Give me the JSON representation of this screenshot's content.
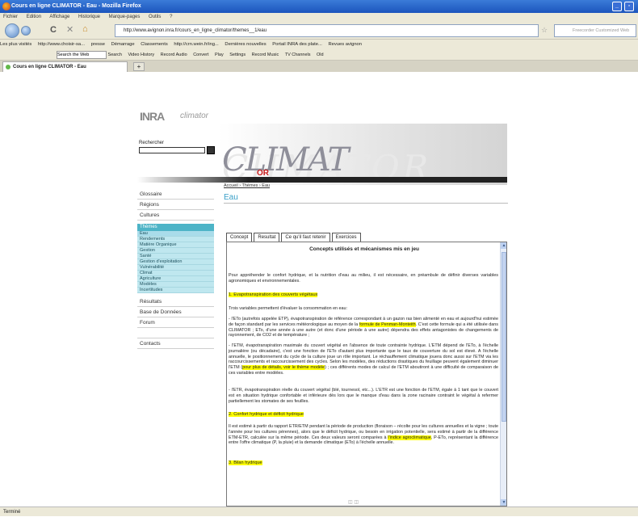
{
  "window": {
    "title": "Cours en ligne CLIMATOR - Eau - Mozilla Firefox"
  },
  "menu": [
    "Fichier",
    "Edition",
    "Affichage",
    "Historique",
    "Marque-pages",
    "Outils",
    "?"
  ],
  "nav": {
    "url": "http://www.avignon.inra.fr/cours_en_ligne_climator/themes__1/eau",
    "search_placeholder": "Freecorder Customized Web Search"
  },
  "bookmarks": [
    "Les plus visités",
    "http://www.choisir-sa...",
    "presse",
    "Démarrage",
    "Classements",
    "http://crn.wein.fr/ing...",
    "Dernières nouvelles",
    "Portail INRA des plate...",
    "Revues avignon"
  ],
  "toolbar2": {
    "search_value": "Search the Web",
    "items": [
      "Search",
      "Video History",
      "Record Audio",
      "Convert",
      "Play",
      "Settings",
      "Record Music",
      "TV Channels",
      "Old"
    ]
  },
  "tab": {
    "label": "Cours en ligne CLIMATOR - Eau",
    "new_tab": "+"
  },
  "site": {
    "logo_inra": "INRA",
    "logo_small": "climator",
    "search_label": "Rechercher",
    "banner_title": "CLIMAT",
    "banner_ghost": "ClIMATOR",
    "banner_or": "OR"
  },
  "sidebar": {
    "top_items": [
      "Glossaire",
      "Régions",
      "Cultures"
    ],
    "themes_head": "Thèmes",
    "themes": [
      "Eau",
      "Rendements",
      "Matière Organique",
      "Gestion",
      "Santé",
      "Gestion d'exploitation",
      "Vulnérabilité",
      "Climat",
      "Agriculture",
      "Modèles",
      "Incertitudes"
    ],
    "bottom_items": [
      "Résultats",
      "Base de Données",
      "Forum",
      "",
      "Contacts"
    ]
  },
  "breadcrumb": "Accueil › Thèmes › Eau",
  "page_title": "Eau",
  "content_tabs": [
    "Concept",
    "Resultat",
    "Ce qu'il faut retenir",
    "Exercices"
  ],
  "content": {
    "title": "Concepts utilisés et mécanismes mis en jeu",
    "intro": "Pour appréhender le confort hydrique, et la nutrition d'eau au milieu, il est nécessaire, en préambule de définir diverses variables agronomiques et environnementales.",
    "heading1": "1. Evapotranspiration des couverts végétaux",
    "p1": "Trois variables permettent d'évaluer la consommation en eau:",
    "p2a": "- l'ETo (autrefois appelée ETP), évapotranspiration de référence correspondant à un gazon ras bien alimenté en eau et aujourd'hui estimée de façon standard par les services météorologique au moyen de la ",
    "p2hl": "formule de Penman-Monteith",
    "p2b": ". C'est cette formule qui a été utilisée dans CLIMATOR ; ETo, d'une année à une autre (et donc d'une période à une autre) dépendra des effets antagonistes de changements de rayonnement, de CO2 et de température ;",
    "p3a": "- l'ETM, évapotranspiration maximale du couvert végétal en l'absence de toute contrainte hydrique. L'ETM dépend de l'ETo, à l'échelle journalière (ou décadaire), c'est une fonction de l'ETo d'autant plus importante que le taux de couverture du sol est élevé. A l'échelle annuelle, le positionnement du cycle de la culture joue un rôle important. Le réchauffement climatique jouera donc aussi sur l'ETM via les raccourcissements et raccourcissement des cycles. Selon les modèles, des réductions drastiques du feuillage peuvent également diminuer l'ETM (",
    "p3hl": "pour plus de détails, voir le thème modèle",
    "p3b": ") ; ces différents modes de calcul de l'ETM aboutiront à une difficulté de comparaison de ces variables entre modèles.",
    "p4": "- l'ETR, évapotranspiration réelle du couvert végétal (blé, tournesol, etc...). L'ETR est une fonction de l'ETM, égale à 1 tant que le couvert est en situation hydrique confortable et inférieure dès lors que le manque d'eau dans la zone racinaire contraint le végétal à refermer partiellement les stomates de ses feuilles.",
    "heading2": "2. Confort hydrique et déficit hydrique",
    "p5a": "Il est estimé à partir du rapport ETR/ETM pendant la période de production (floraison – récolte pour les cultures annuelles et la vigne ; toute l'année pour les cultures pérennes), alors que le déficit hydrique, ou besoin en irrigation potentielle, sera estimé à partir de la différence ETM-ETR, calculée sur la même période. Ces deux valeurs seront comparées à ",
    "p5hl": "l'indice agroclimatique",
    "p5b": ", P-ETo, représentant la différence entre l'offre climatique (P, la pluie) et la demande climatique (ETo) à l'échelle annuelle.",
    "heading3": "3. Bilan hydrique",
    "pager": "◫ ◫"
  },
  "status": "Terminé"
}
